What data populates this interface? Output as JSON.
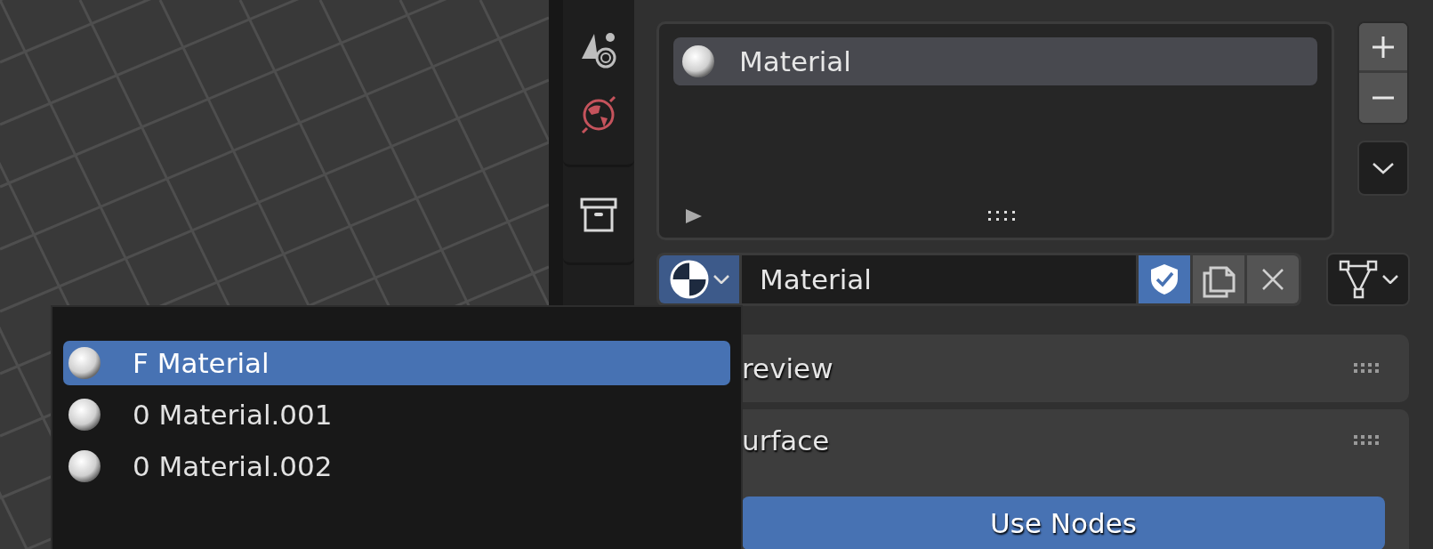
{
  "material_slots": {
    "items": [
      {
        "label": "Material",
        "selected": true
      }
    ]
  },
  "material_selector": {
    "name": "Material",
    "fake_user": true
  },
  "panels": [
    {
      "title": "review"
    },
    {
      "title": "urface",
      "use_nodes": {
        "label": "Use Nodes",
        "on": true
      }
    }
  ],
  "menu": {
    "items": [
      {
        "text": "F Material",
        "selected": true
      },
      {
        "text": "0 Material.001",
        "selected": false
      },
      {
        "text": "0 Material.002",
        "selected": false
      }
    ]
  }
}
